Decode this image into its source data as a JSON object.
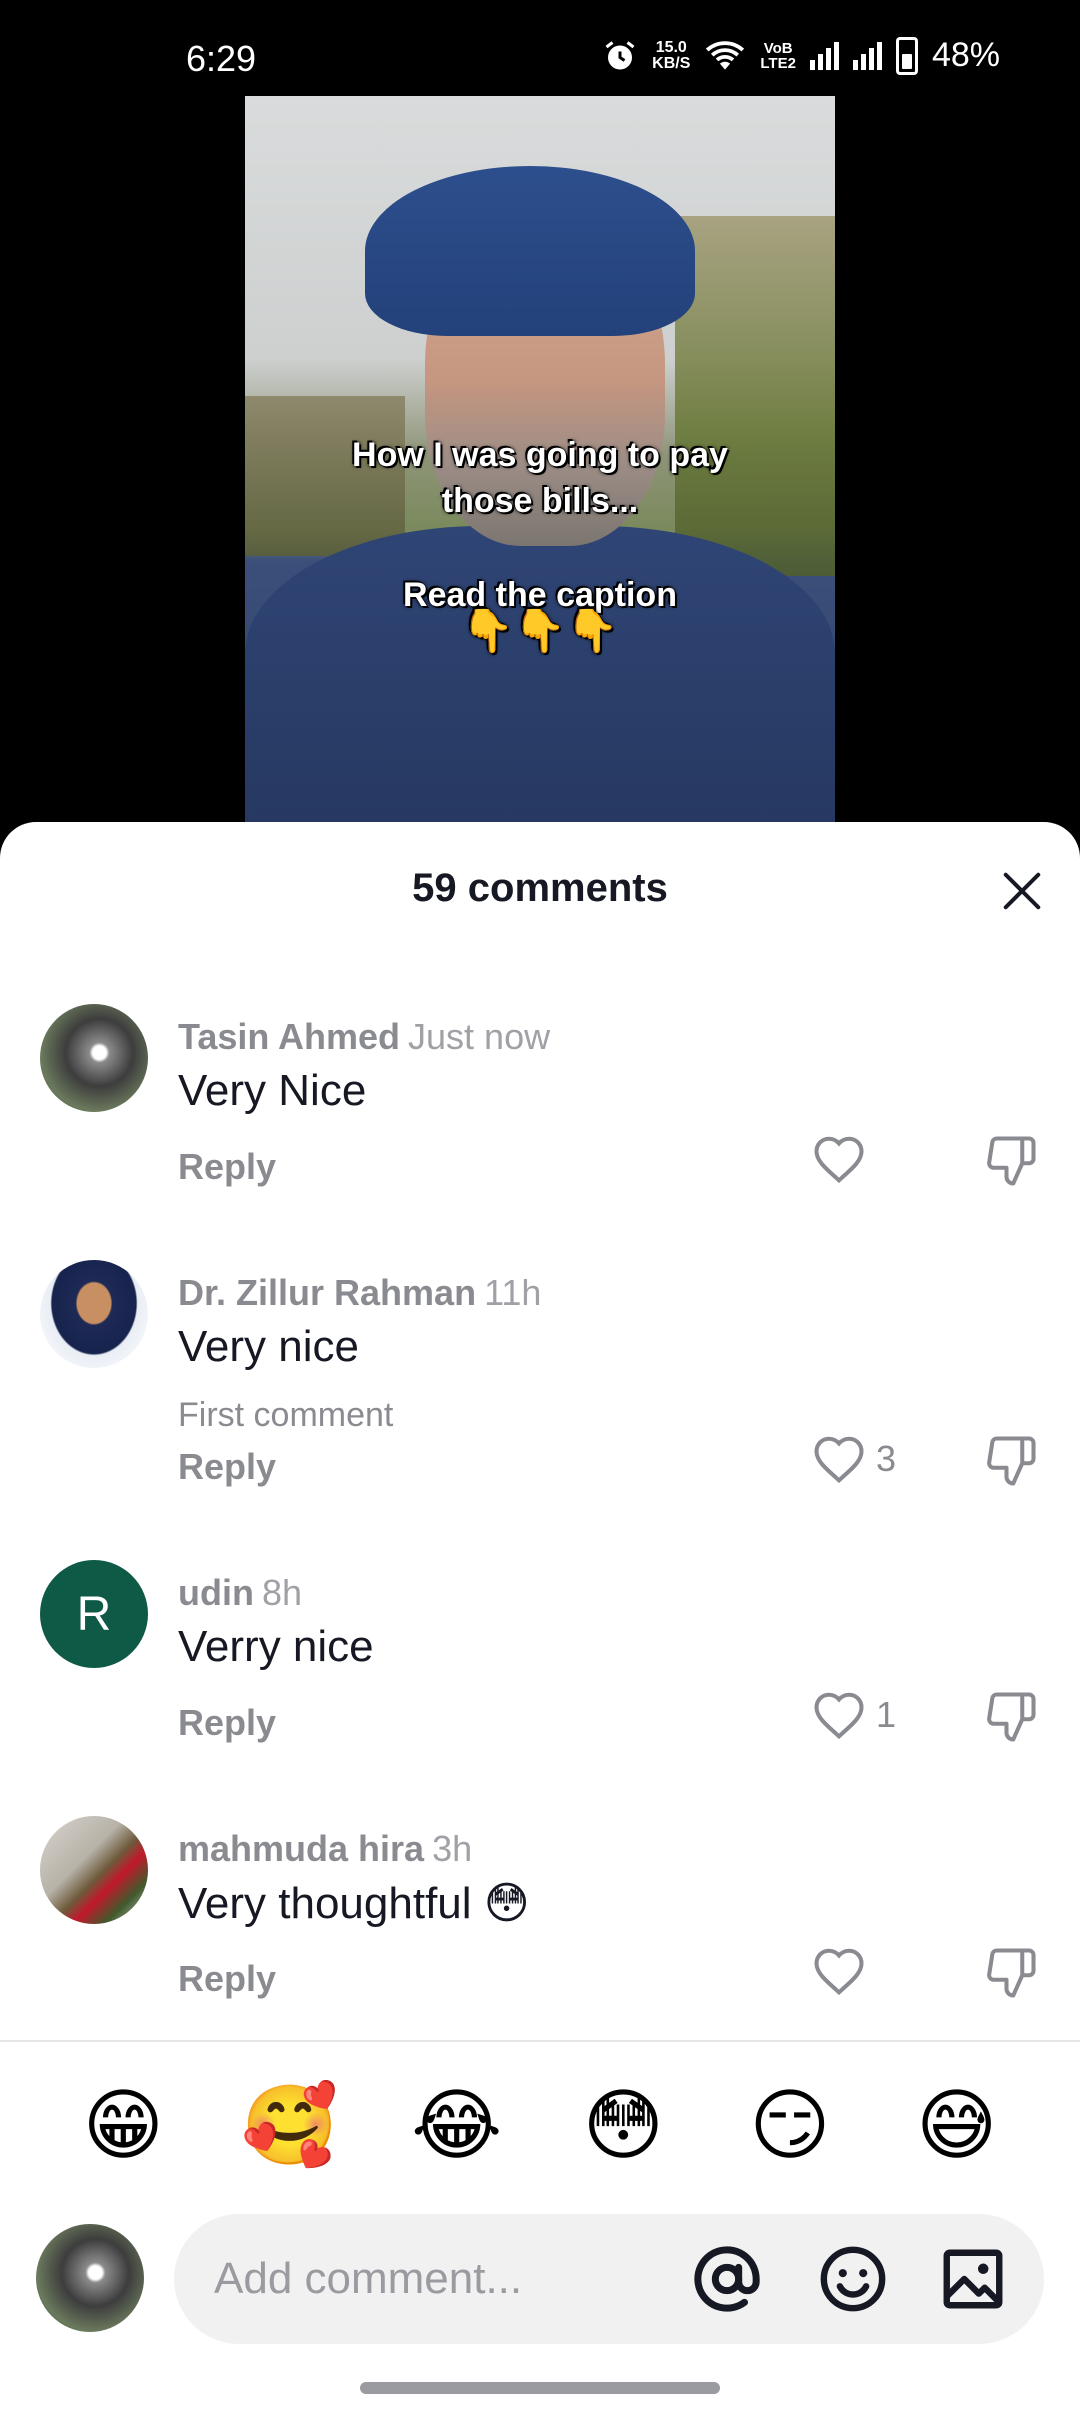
{
  "status_bar": {
    "time": "6:29",
    "net_speed_value": "15.0",
    "net_speed_unit": "KB/S",
    "volte_top": "VoB",
    "volte_bottom": "LTE2",
    "battery": "48%"
  },
  "video": {
    "caption_line1": "How I was going to pay",
    "caption_line2": "those bills...",
    "caption_line3": "Read the caption",
    "caption_emojis": "👇👇👇"
  },
  "sheet": {
    "title": "59 comments"
  },
  "comments": [
    {
      "name": "Tasin Ahmed",
      "time": "Just now",
      "text": "Very Nice",
      "meta": "",
      "reply_label": "Reply",
      "likes": ""
    },
    {
      "name": "Dr. Zillur Rahman",
      "time": "11h",
      "text": "Very nice",
      "meta": "First comment",
      "reply_label": "Reply",
      "likes": "3"
    },
    {
      "name": "udin",
      "time": "8h",
      "text": "Verry nice",
      "meta": "",
      "reply_label": "Reply",
      "likes": "1",
      "avatar_letter": "R"
    },
    {
      "name": "mahmuda hira",
      "time": "3h",
      "text": "Very thoughtful 😳",
      "meta": "",
      "reply_label": "Reply",
      "likes": ""
    }
  ],
  "quick_emojis": [
    "😁",
    "🥰",
    "😂",
    "😳",
    "😏",
    "😅"
  ],
  "input": {
    "placeholder": "Add comment..."
  },
  "icons": {
    "close": "close-icon",
    "like": "heart-icon",
    "dislike": "thumbs-down-icon",
    "mention": "at-icon",
    "emoji": "smiley-icon",
    "image": "image-icon"
  }
}
